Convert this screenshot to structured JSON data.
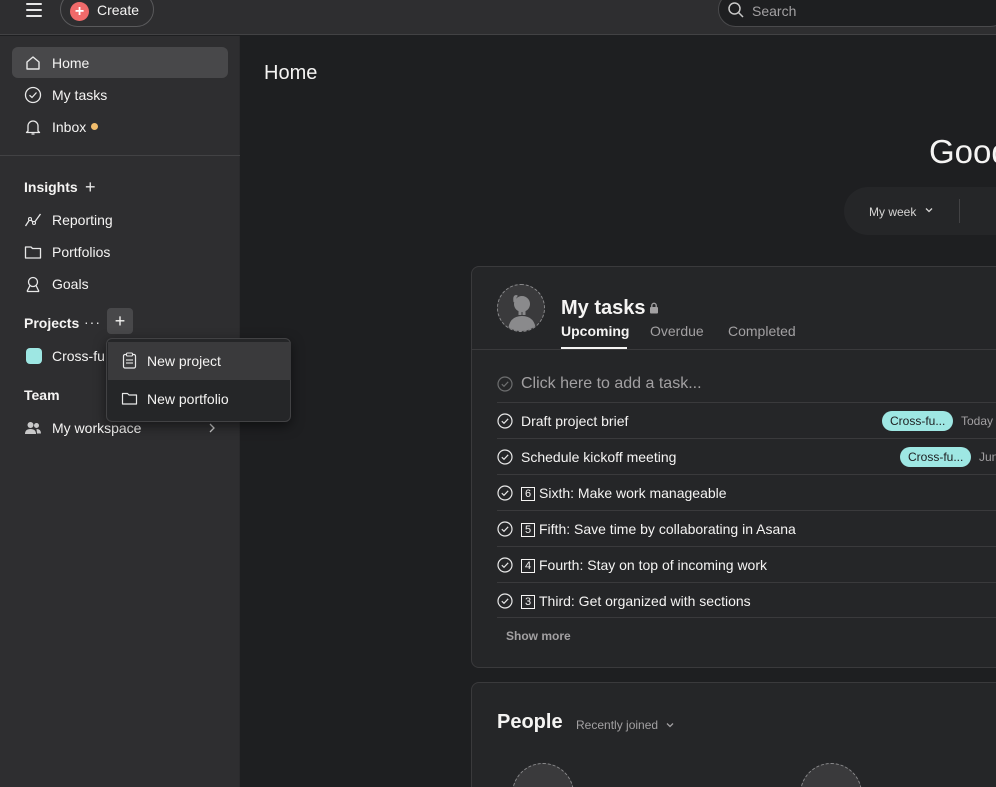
{
  "topbar": {
    "create_label": "Create",
    "search_placeholder": "Search"
  },
  "sidebar": {
    "nav": [
      {
        "label": "Home",
        "icon": "home-icon"
      },
      {
        "label": "My tasks",
        "icon": "check-circle-icon"
      },
      {
        "label": "Inbox",
        "icon": "bell-icon"
      }
    ],
    "insights": {
      "title": "Insights",
      "items": [
        {
          "label": "Reporting",
          "icon": "line-chart-icon"
        },
        {
          "label": "Portfolios",
          "icon": "folder-icon"
        },
        {
          "label": "Goals",
          "icon": "person-icon"
        }
      ]
    },
    "projects": {
      "title": "Projects",
      "items": [
        {
          "label": "Cross-fu",
          "color": "#9ee7e3"
        }
      ]
    },
    "team": {
      "title": "Team",
      "items": [
        {
          "label": "My workspace",
          "icon": "people-icon"
        }
      ]
    },
    "inbox_dot_color": "#f1bd6c"
  },
  "dropdown": {
    "items": [
      {
        "label": "New project",
        "icon": "clipboard-icon"
      },
      {
        "label": "New portfolio",
        "icon": "folder-icon"
      }
    ]
  },
  "main": {
    "page_title": "Home",
    "greeting": "Good",
    "week_filter": "My week"
  },
  "my_tasks": {
    "title": "My tasks",
    "tabs": [
      "Upcoming",
      "Overdue",
      "Completed"
    ],
    "add_task_placeholder": "Click here to add a task...",
    "tasks": [
      {
        "label": "Draft project brief",
        "tag": "Cross-fu...",
        "due": "Today –"
      },
      {
        "label": "Schedule kickoff meeting",
        "tag": "Cross-fu...",
        "due": "Jun"
      },
      {
        "num": "6",
        "label": "Sixth: Make work manageable"
      },
      {
        "num": "5",
        "label": "Fifth: Save time by collaborating in Asana"
      },
      {
        "num": "4",
        "label": "Fourth: Stay on top of incoming work"
      },
      {
        "num": "3",
        "label": "Third: Get organized with sections"
      }
    ],
    "show_more": "Show more"
  },
  "people": {
    "title": "People",
    "filter": "Recently joined"
  },
  "colors": {
    "accent_create": "#f06a6a",
    "tag": "#9ee7e3",
    "bg": "#1e1f21",
    "sidebar": "#2e2e30"
  }
}
